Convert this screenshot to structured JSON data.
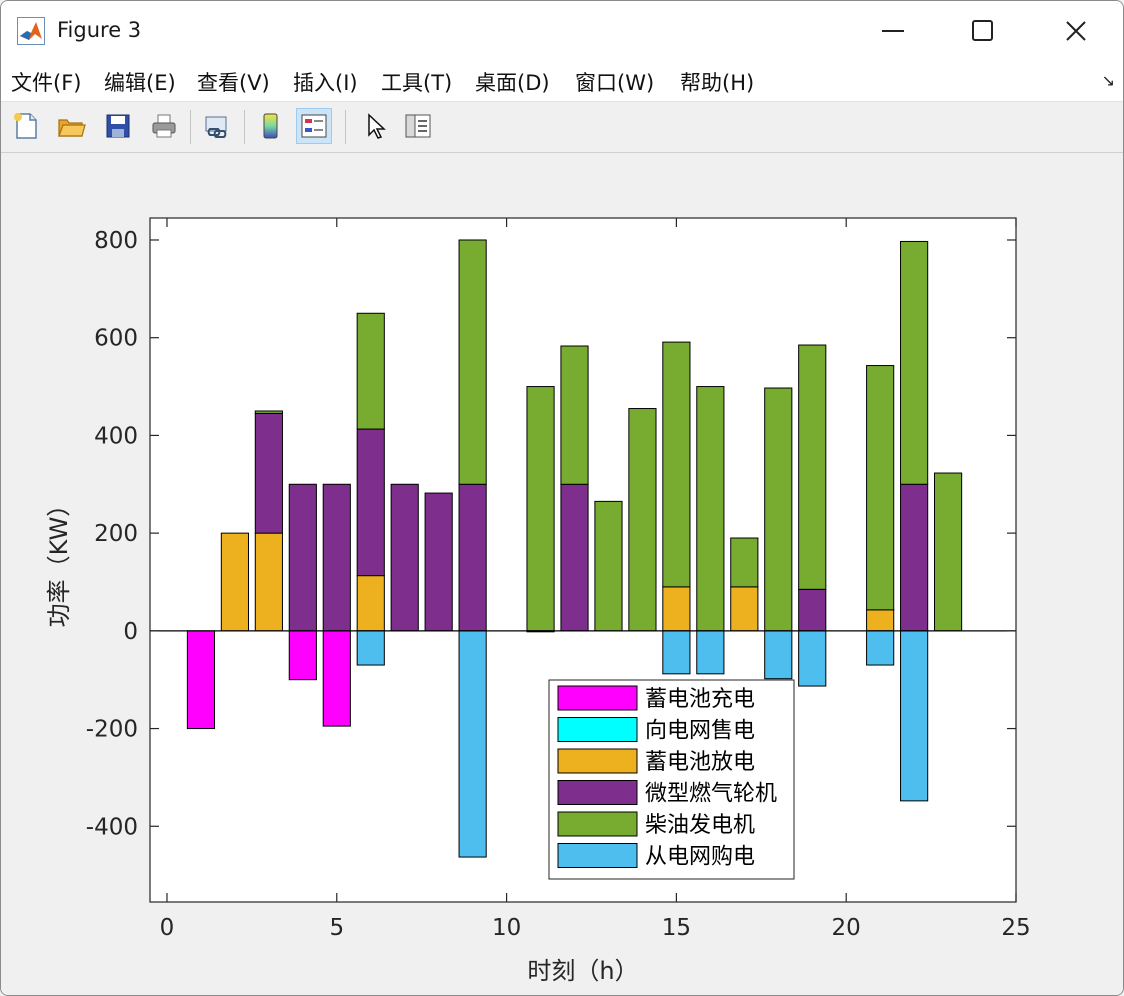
{
  "window": {
    "title": "Figure 3"
  },
  "menu": [
    "文件(F)",
    "编辑(E)",
    "查看(V)",
    "插入(I)",
    "工具(T)",
    "桌面(D)",
    "窗口(W)",
    "帮助(H)"
  ],
  "menu_arrow": "↘",
  "toolbar_icons": [
    "new-file-icon",
    "open-folder-icon",
    "save-icon",
    "print-icon",
    "link-plot-icon",
    "colorbar-icon",
    "legend-icon",
    "pointer-icon",
    "property-inspector-icon"
  ],
  "colors": {
    "charge": "#ff00ff",
    "sell": "#00ffff",
    "discharge": "#edb120",
    "turbine": "#7e2f8e",
    "diesel": "#77ac30",
    "buy": "#4dbeee"
  },
  "chart_data": {
    "type": "bar",
    "stacked": true,
    "xlabel": "时刻（h）",
    "ylabel": "功率（KW）",
    "xlim": [
      -0.5,
      25
    ],
    "ylim": [
      -555,
      845
    ],
    "xticks": [
      0,
      5,
      10,
      15,
      20,
      25
    ],
    "yticks": [
      -400,
      -200,
      0,
      200,
      400,
      600,
      800
    ],
    "legend_position": "bottom-center",
    "x": [
      1,
      2,
      3,
      4,
      5,
      6,
      7,
      8,
      9,
      10,
      11,
      12,
      13,
      14,
      15,
      16,
      17,
      18,
      19,
      20,
      21,
      22,
      23
    ],
    "series": [
      {
        "name": "蓄电池充电",
        "key": "charge",
        "values": [
          -200,
          0,
          0,
          -100,
          -195,
          0,
          0,
          0,
          0,
          0,
          0,
          0,
          0,
          0,
          0,
          0,
          0,
          0,
          0,
          0,
          0,
          0,
          0
        ]
      },
      {
        "name": "向电网售电",
        "key": "sell",
        "values": [
          0,
          0,
          0,
          0,
          0,
          0,
          0,
          0,
          0,
          0,
          0,
          0,
          0,
          0,
          0,
          0,
          0,
          0,
          0,
          0,
          0,
          0,
          0
        ]
      },
      {
        "name": "蓄电池放电",
        "key": "discharge",
        "values": [
          0,
          200,
          200,
          0,
          0,
          113,
          0,
          0,
          0,
          0,
          0,
          0,
          0,
          0,
          90,
          0,
          90,
          0,
          0,
          0,
          43,
          0,
          0
        ]
      },
      {
        "name": "微型燃气轮机",
        "key": "turbine",
        "values": [
          0,
          0,
          245,
          300,
          300,
          300,
          300,
          282,
          300,
          0,
          0,
          300,
          0,
          0,
          0,
          0,
          0,
          0,
          85,
          0,
          0,
          300,
          0
        ]
      },
      {
        "name": "柴油发电机",
        "key": "diesel",
        "values": [
          0,
          0,
          5,
          0,
          0,
          237,
          0,
          0,
          500,
          0,
          500,
          283,
          265,
          455,
          501,
          500,
          100,
          497,
          500,
          0,
          500,
          497,
          323
        ]
      },
      {
        "name": "从电网购电",
        "key": "buy",
        "values": [
          0,
          0,
          0,
          0,
          0,
          -70,
          0,
          0,
          -463,
          0,
          -2,
          0,
          0,
          0,
          -88,
          -88,
          0,
          -98,
          -113,
          0,
          -70,
          -348,
          0
        ]
      }
    ]
  }
}
